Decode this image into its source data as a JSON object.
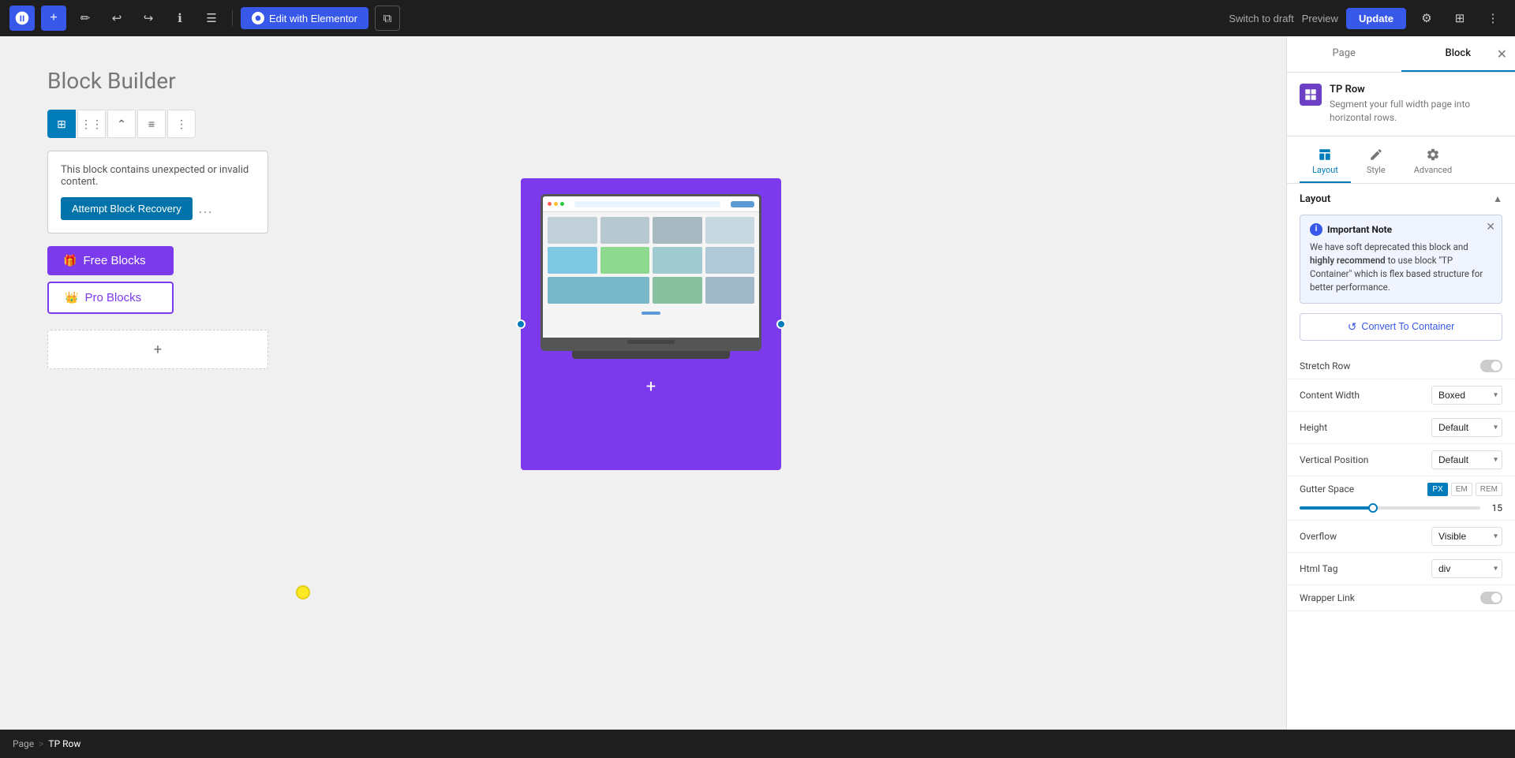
{
  "toolbar": {
    "wp_logo": "W",
    "add_btn": "+",
    "tools_icon": "✏",
    "undo_icon": "↩",
    "redo_icon": "↪",
    "info_icon": "ℹ",
    "list_icon": "☰",
    "elementor_btn": "Edit with Elementor",
    "copy_icon": "⧉",
    "switch_draft": "Switch to draft",
    "preview": "Preview",
    "update": "Update",
    "gear_icon": "⚙",
    "grid_icon": "⊞"
  },
  "editor": {
    "page_title": "Block Builder",
    "block_toolbar": {
      "grid_icon": "⊞",
      "dots_icon": "⋮⋮",
      "arrow_icon": "⌃",
      "align_icon": "≡",
      "more_icon": "⋮"
    },
    "error_block": {
      "message": "This block contains unexpected or invalid content.",
      "attempt_recovery": "Attempt Block Recovery",
      "dots": "..."
    },
    "free_blocks_btn": "Free Blocks",
    "pro_blocks_btn": "Pro Blocks",
    "add_block_plus": "+",
    "image_add_plus": "+"
  },
  "right_panel": {
    "tabs": {
      "page": "Page",
      "block": "Block"
    },
    "block_name": "TP Row",
    "block_description": "Segment your full width page into horizontal rows.",
    "subtabs": {
      "layout": "Layout",
      "style": "Style",
      "advanced": "Advanced"
    },
    "layout_section": "Layout",
    "important_note": {
      "title": "Important Note",
      "text": "We have soft deprecated this block and highly recommend to use block \"TP Container\" which is flex based structure for better performance.",
      "info_icon": "i"
    },
    "convert_btn": "Convert To Container",
    "stretch_row": "Stretch Row",
    "content_width": {
      "label": "Content Width",
      "value": "Boxed"
    },
    "height": {
      "label": "Height",
      "value": "Default"
    },
    "vertical_position": {
      "label": "Vertical Position",
      "value": "Default"
    },
    "gutter_space": {
      "label": "Gutter Space",
      "units": [
        "PX",
        "EM",
        "REM"
      ],
      "active_unit": "PX",
      "value": "15"
    },
    "overflow": {
      "label": "Overflow",
      "value": "Visible"
    },
    "html_tag": {
      "label": "Html Tag",
      "value": "div"
    },
    "wrapper_link": "Wrapper Link"
  },
  "breadcrumb": {
    "page": "Page",
    "separator": ">",
    "tp_row": "TP Row"
  }
}
